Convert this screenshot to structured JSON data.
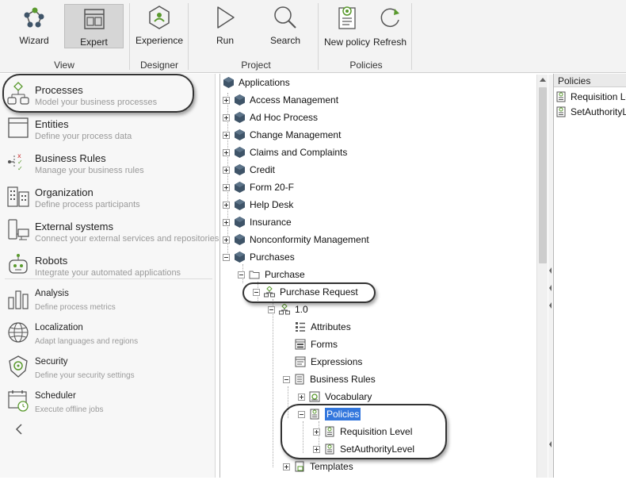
{
  "ribbon": {
    "buttons": {
      "wizard": "Wizard",
      "expert": "Expert",
      "experience": "Experience",
      "run": "Run",
      "search": "Search",
      "new_policy": "New policy",
      "refresh": "Refresh"
    },
    "groups": {
      "view": "View",
      "designer": "Designer",
      "project": "Project",
      "policies": "Policies"
    },
    "active_button": "Expert"
  },
  "leftnav": {
    "items": [
      {
        "title": "Processes",
        "subtitle": "Model your business processes",
        "icon": "processes-icon"
      },
      {
        "title": "Entities",
        "subtitle": "Define your process data",
        "icon": "entities-icon"
      },
      {
        "title": "Business Rules",
        "subtitle": "Manage your business rules",
        "icon": "business-rules-icon"
      },
      {
        "title": "Organization",
        "subtitle": "Define process participants",
        "icon": "organization-icon"
      },
      {
        "title": "External systems",
        "subtitle": "Connect your external services and repositories",
        "icon": "external-systems-icon"
      },
      {
        "title": "Robots",
        "subtitle": "Integrate your automated applications",
        "icon": "robots-icon"
      },
      {
        "title": "Analysis",
        "subtitle": "Define process metrics",
        "icon": "analysis-icon"
      },
      {
        "title": "Localization",
        "subtitle": "Adapt languages and regions",
        "icon": "localization-icon"
      },
      {
        "title": "Security",
        "subtitle": "Define your security settings",
        "icon": "security-icon"
      },
      {
        "title": "Scheduler",
        "subtitle": "Execute offline jobs",
        "icon": "scheduler-icon"
      }
    ],
    "collapse_icon": "chevron-left-icon"
  },
  "tree": {
    "root": "Applications",
    "apps": [
      "Access Management",
      "Ad Hoc Process",
      "Change Management",
      "Claims and Complaints",
      "Credit",
      "Form 20-F",
      "Help Desk",
      "Insurance",
      "Nonconformity Management",
      "Purchases"
    ],
    "purchase_folder": "Purchase",
    "process": "Purchase Request",
    "version": "1.0",
    "version_children": [
      "Attributes",
      "Forms",
      "Expressions",
      "Business Rules"
    ],
    "vocabulary": "Vocabulary",
    "policies": "Policies",
    "policy_items": [
      "Requisition Level",
      "SetAuthorityLevel"
    ],
    "templates": "Templates",
    "selected": "Policies"
  },
  "right_panel": {
    "header": "Policies",
    "items": [
      "Requisition Level",
      "SetAuthorityLevel"
    ]
  },
  "colors": {
    "selection": "#3377dd",
    "app_cube": "#3f5468",
    "icon_green": "#5a9a2e"
  }
}
